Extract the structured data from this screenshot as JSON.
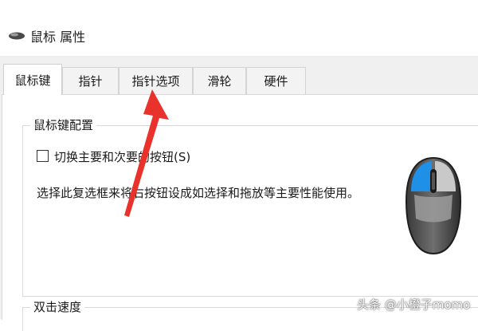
{
  "window": {
    "title": "鼠标 属性",
    "icon": "mouse-icon"
  },
  "tabs": [
    {
      "label": "鼠标键",
      "active": true
    },
    {
      "label": "指针",
      "active": false
    },
    {
      "label": "指针选项",
      "active": false
    },
    {
      "label": "滑轮",
      "active": false
    },
    {
      "label": "硬件",
      "active": false
    }
  ],
  "button_config": {
    "legend": "鼠标键配置",
    "checkbox_label": "切换主要和次要的按钮(S)",
    "checkbox_checked": false,
    "description": "选择此复选框来将右按钮设成如选择和拖放等主要性能使用。"
  },
  "double_click": {
    "legend": "双击速度"
  },
  "watermark": "头条 @小橙子momo",
  "colors": {
    "arrow": "#e8322b",
    "mouse_highlight": "#1e90e8"
  }
}
